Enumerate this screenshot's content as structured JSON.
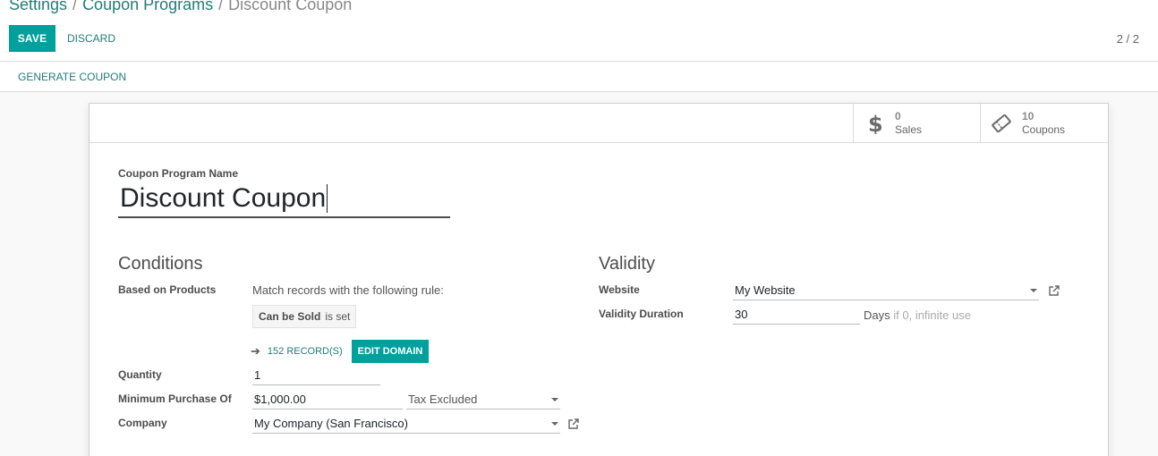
{
  "breadcrumb": {
    "items": [
      "Settings",
      "Coupon Programs"
    ],
    "active": "Discount Coupon",
    "separator": "/"
  },
  "toolbar": {
    "save_label": "SAVE",
    "discard_label": "DISCARD",
    "pager": "2 / 2"
  },
  "statusbar": {
    "generate_label": "GENERATE COUPON"
  },
  "smart_buttons": [
    {
      "icon": "dollar-icon",
      "value": "0",
      "label": "Sales"
    },
    {
      "icon": "ticket-icon",
      "value": "10",
      "label": "Coupons"
    }
  ],
  "form": {
    "name_label": "Coupon Program Name",
    "name_value": "Discount Coupon",
    "conditions": {
      "title": "Conditions",
      "based_on_products_label": "Based on Products",
      "rule_text": "Match records with the following rule:",
      "domain_field": "Can be Sold",
      "domain_op": "is set",
      "records_link": "152 RECORD(S)",
      "edit_domain_label": "EDIT DOMAIN",
      "quantity_label": "Quantity",
      "quantity_value": "1",
      "min_purchase_label": "Minimum Purchase Of",
      "min_purchase_value": "$1,000.00",
      "tax_value": "Tax Excluded",
      "company_label": "Company",
      "company_value": "My Company (San Francisco)"
    },
    "validity": {
      "title": "Validity",
      "website_label": "Website",
      "website_value": "My Website",
      "duration_label": "Validity Duration",
      "duration_value": "30",
      "duration_unit": "Days",
      "duration_hint": "if 0, infinite use"
    }
  },
  "colors": {
    "primary": "#00a09d",
    "link": "#217d79",
    "text": "#4c4c4c"
  }
}
